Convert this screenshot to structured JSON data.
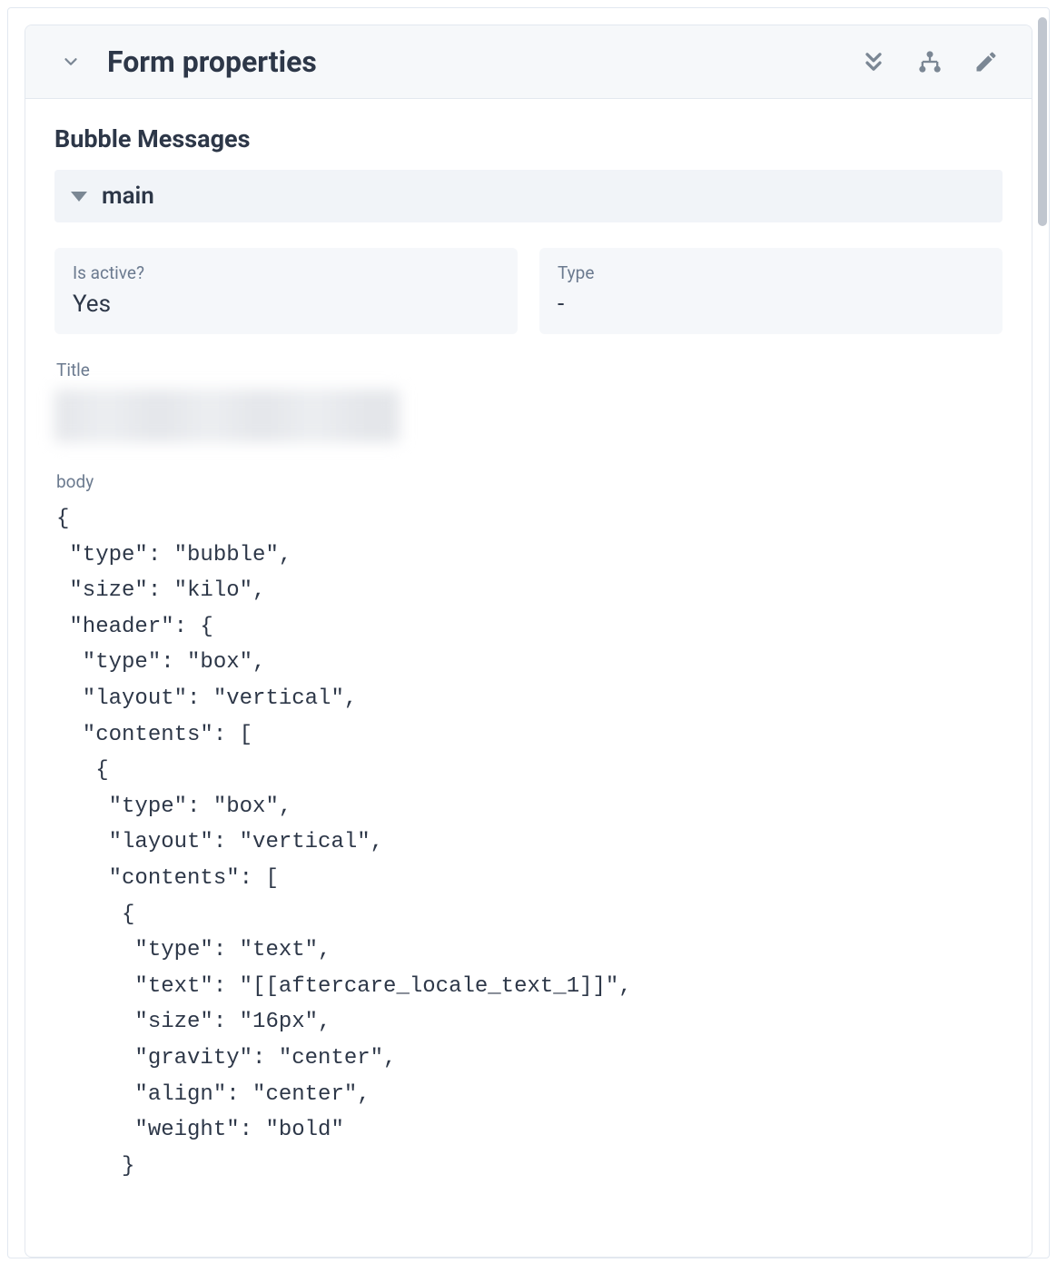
{
  "panel": {
    "title": "Form properties"
  },
  "section": {
    "title": "Bubble Messages",
    "sub_name": "main"
  },
  "fields": {
    "is_active": {
      "label": "Is active?",
      "value": "Yes"
    },
    "type": {
      "label": "Type",
      "value": "-"
    },
    "title": {
      "label": "Title"
    },
    "body": {
      "label": "body",
      "code": "{\n \"type\": \"bubble\",\n \"size\": \"kilo\",\n \"header\": {\n  \"type\": \"box\",\n  \"layout\": \"vertical\",\n  \"contents\": [\n   {\n    \"type\": \"box\",\n    \"layout\": \"vertical\",\n    \"contents\": [\n     {\n      \"type\": \"text\",\n      \"text\": \"[[aftercare_locale_text_1]]\",\n      \"size\": \"16px\",\n      \"gravity\": \"center\",\n      \"align\": \"center\",\n      \"weight\": \"bold\"\n     }"
    }
  }
}
